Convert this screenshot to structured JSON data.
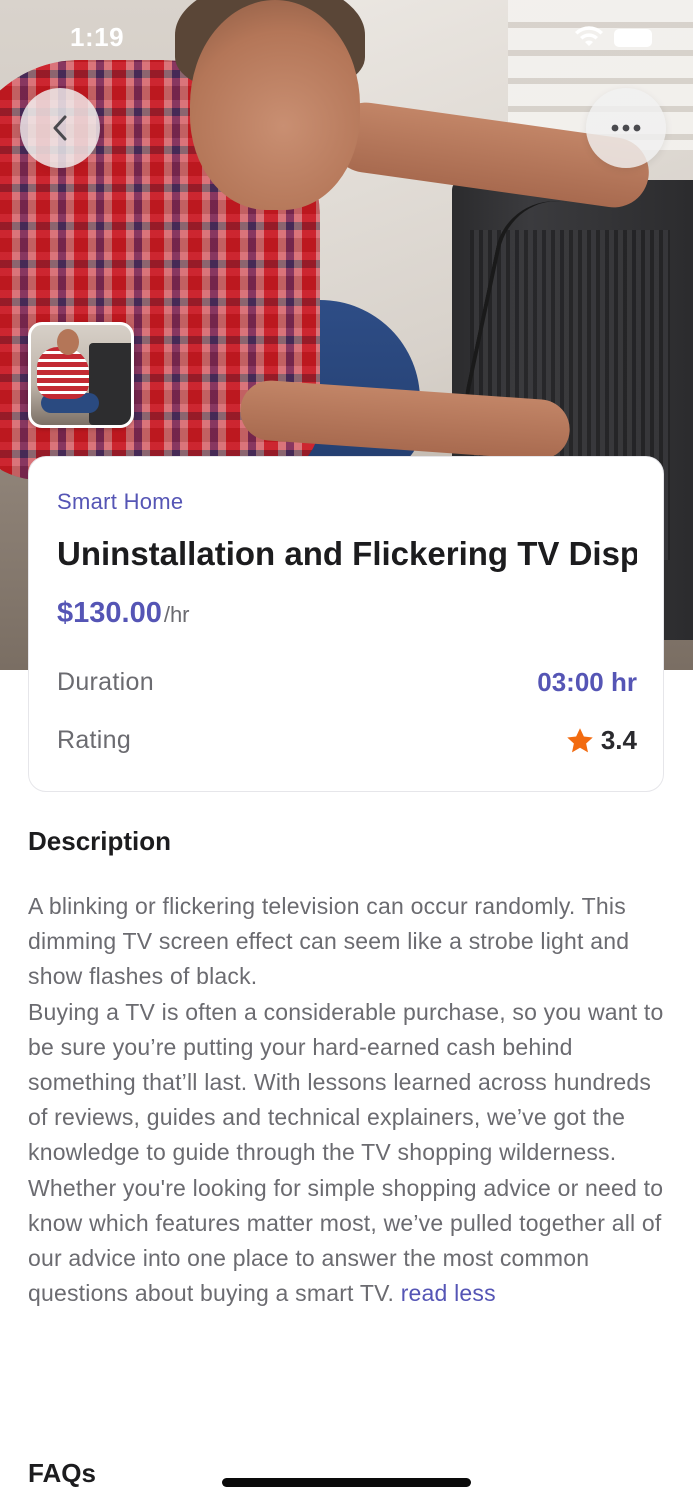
{
  "status_bar": {
    "time": "1:19",
    "icons": [
      "wifi-icon",
      "battery-icon"
    ]
  },
  "nav": {
    "back_icon": "chevron-left-icon",
    "more_icon": "more-horizontal-icon"
  },
  "service": {
    "category": "Smart Home",
    "title": "Uninstallation and Flickering TV Display",
    "price": "$130.00",
    "price_unit": "/hr",
    "duration_label": "Duration",
    "duration_value": "03:00 hr",
    "rating_label": "Rating",
    "rating_value": "3.4",
    "rating_icon": "star-icon"
  },
  "description": {
    "heading": "Description",
    "paragraphs": [
      "A blinking or flickering television can occur randomly. This dimming TV screen effect can seem like a strobe light and show flashes of black.",
      "Buying a TV is often a considerable purchase, so you want to be sure you’re putting your hard-earned cash behind something that’ll last. With lessons learned across hundreds of reviews, guides and technical explainers, we’ve got the knowledge to guide through the TV shopping wilderness.",
      "Whether you're looking for simple shopping advice or need to know which features matter most, we’ve pulled together all of our advice into one place to answer the most common questions about buying a smart TV."
    ],
    "toggle_label": "read less"
  },
  "faqs": {
    "heading": "FAQs"
  },
  "colors": {
    "accent": "#5555b5",
    "star": "#f26b10",
    "text_primary": "#1c1c1e",
    "text_secondary": "#6b6b70"
  }
}
